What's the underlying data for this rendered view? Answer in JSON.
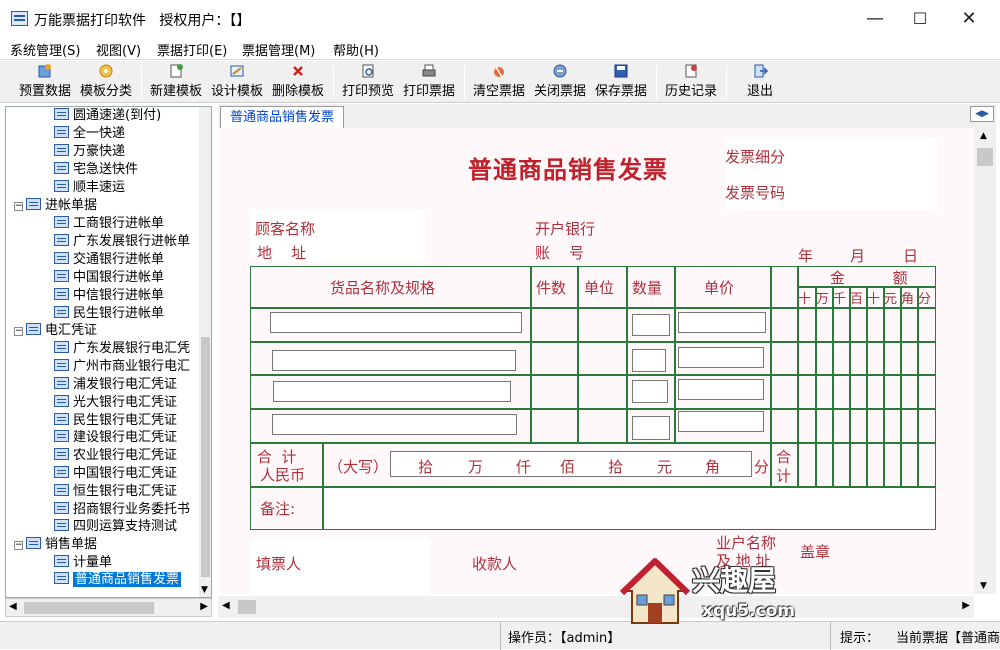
{
  "window": {
    "title": "万能票据打印软件   授权用户：【】",
    "minimize": "—",
    "maximize": "☐",
    "close": "✕"
  },
  "menu": [
    "系统管理(S)",
    "视图(V)",
    "票据打印(E)",
    "票据管理(M)",
    "帮助(H)"
  ],
  "toolbar": [
    {
      "label": "预置数据",
      "icon": "preset-icon"
    },
    {
      "label": "模板分类",
      "icon": "category-icon"
    },
    {
      "label": "新建模板",
      "icon": "new-template-icon"
    },
    {
      "label": "设计模板",
      "icon": "design-icon"
    },
    {
      "label": "删除模板",
      "icon": "delete-icon"
    },
    {
      "label": "打印预览",
      "icon": "preview-icon"
    },
    {
      "label": "打印票据",
      "icon": "printer-icon"
    },
    {
      "label": "清空票据",
      "icon": "clear-icon"
    },
    {
      "label": "关闭票据",
      "icon": "close-doc-icon"
    },
    {
      "label": "保存票据",
      "icon": "save-icon"
    },
    {
      "label": "历史记录",
      "icon": "history-icon"
    },
    {
      "label": "退出",
      "icon": "exit-icon"
    }
  ],
  "tree": {
    "items": [
      {
        "label": "圆通速递(到付)",
        "level": 2
      },
      {
        "label": "全一快递",
        "level": 2
      },
      {
        "label": "万豪快递",
        "level": 2
      },
      {
        "label": "宅急送快件",
        "level": 2
      },
      {
        "label": "顺丰速运",
        "level": 2
      },
      {
        "label": "进帐单据",
        "level": 1
      },
      {
        "label": "工商银行进帐单",
        "level": 2
      },
      {
        "label": "广东发展银行进帐单",
        "level": 2
      },
      {
        "label": "交通银行进帐单",
        "level": 2
      },
      {
        "label": "中国银行进帐单",
        "level": 2
      },
      {
        "label": "中信银行进帐单",
        "level": 2
      },
      {
        "label": "民生银行进帐单",
        "level": 2
      },
      {
        "label": "电汇凭证",
        "level": 1
      },
      {
        "label": "广东发展银行电汇凭",
        "level": 2
      },
      {
        "label": "广州市商业银行电汇",
        "level": 2
      },
      {
        "label": "浦发银行电汇凭证",
        "level": 2
      },
      {
        "label": "光大银行电汇凭证",
        "level": 2
      },
      {
        "label": "民生银行电汇凭证",
        "level": 2
      },
      {
        "label": "建设银行电汇凭证",
        "level": 2
      },
      {
        "label": "农业银行电汇凭证",
        "level": 2
      },
      {
        "label": "中国银行电汇凭证",
        "level": 2
      },
      {
        "label": "恒生银行电汇凭证",
        "level": 2
      },
      {
        "label": "招商银行业务委托书",
        "level": 2
      },
      {
        "label": "四则运算支持测试",
        "level": 2
      },
      {
        "label": "销售单据",
        "level": 1
      },
      {
        "label": "计量单",
        "level": 2
      },
      {
        "label": "普通商品销售发票",
        "level": 2,
        "selected": true
      }
    ]
  },
  "tab": {
    "label": "普通商品销售发票"
  },
  "invoice": {
    "title": "普通商品销售发票",
    "detail_label": "发票细分",
    "number_label": "发票号码",
    "customer_label": "顾客名称",
    "address_label": "地    址",
    "bank_label": "开户银行",
    "account_label": "账    号",
    "date_year": "年",
    "date_month": "月",
    "date_day": "日",
    "col_goods": "货品名称及规格",
    "col_pieces": "件数",
    "col_unit": "单位",
    "col_qty": "数量",
    "col_price": "单价",
    "col_amount": "金          额",
    "amount_units": [
      "十",
      "万",
      "千",
      "百",
      "十",
      "元",
      "角",
      "分"
    ],
    "total_label_1": "合  计",
    "total_label_2": "人民币",
    "capital_label": "（大写）",
    "capital_units": [
      "拾",
      "万",
      "仟",
      "佰",
      "拾",
      "元",
      "角"
    ],
    "capital_fen": "分",
    "sum_label_1": "合",
    "sum_label_2": "计",
    "remark_label": "备注:",
    "drawer_label": "填票人",
    "payee_label": "收款人",
    "company_label_1": "业户名称",
    "company_label_2": "及 地 址",
    "seal_label": "盖章"
  },
  "status": {
    "operator": "操作员：【admin】",
    "hint": "提示：",
    "current": "当前票据【普通商"
  },
  "watermark": {
    "cn": "兴趣屋",
    "url": "xqu5.com"
  },
  "colors": {
    "accent": "#0078d7",
    "grid_green": "#2a7a3a",
    "title_red": "#c0202a"
  }
}
